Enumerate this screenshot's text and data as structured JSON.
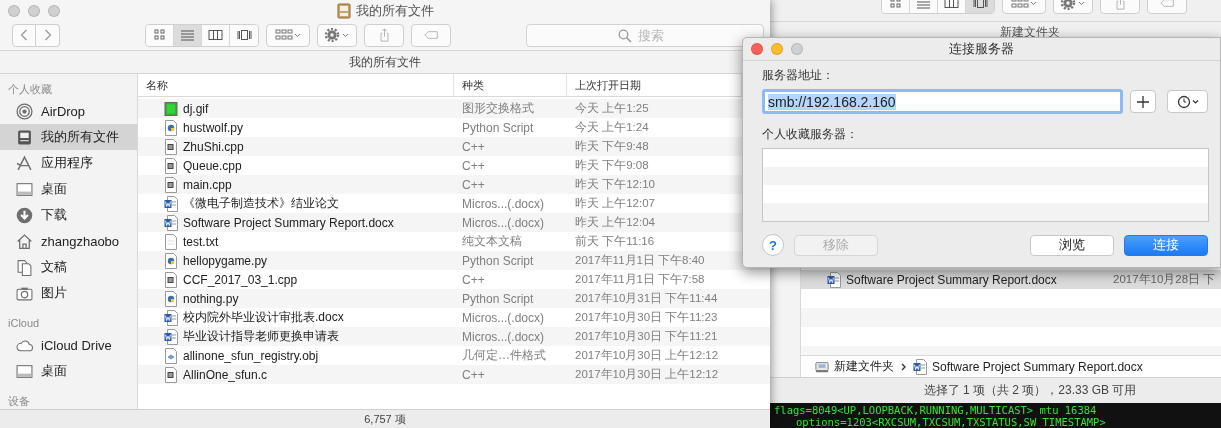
{
  "finder": {
    "active": false,
    "title": "我的所有文件",
    "view_modes": [
      {
        "kind": "icons",
        "selected": false
      },
      {
        "kind": "list",
        "selected": true
      },
      {
        "kind": "columns",
        "selected": false
      },
      {
        "kind": "coverflow",
        "selected": false
      }
    ],
    "search": {
      "placeholder": "搜索"
    },
    "path_title": "我的所有文件",
    "sidebar": [
      {
        "header": "个人收藏",
        "items": [
          {
            "kind": "airdrop",
            "label": "AirDrop",
            "selected": false
          },
          {
            "kind": "allfiles",
            "label": "我的所有文件",
            "selected": true
          },
          {
            "kind": "apps",
            "label": "应用程序",
            "selected": false
          },
          {
            "kind": "desktop",
            "label": "桌面",
            "selected": false
          },
          {
            "kind": "downloads",
            "label": "下载",
            "selected": false
          },
          {
            "kind": "home",
            "label": "zhangzhaobo",
            "selected": false
          },
          {
            "kind": "documents",
            "label": "文稿",
            "selected": false
          },
          {
            "kind": "pictures",
            "label": "图片",
            "selected": false
          }
        ]
      },
      {
        "header": "iCloud",
        "items": [
          {
            "kind": "icloud",
            "label": "iCloud Drive",
            "selected": false
          },
          {
            "kind": "desktop",
            "label": "桌面",
            "selected": false
          }
        ]
      },
      {
        "header": "设备"
      }
    ],
    "columns": [
      "名称",
      "种类",
      "上次打开日期"
    ],
    "rows": [
      {
        "kind": "gif",
        "name": "dj.gif",
        "type": "图形交换格式",
        "date": "今天 上午1:25"
      },
      {
        "kind": "py",
        "name": "hustwolf.py",
        "type": "Python Script",
        "date": "今天 上午1:24"
      },
      {
        "kind": "cpp",
        "name": "ZhuShi.cpp",
        "type": "C++",
        "date": "昨天 下午9:48"
      },
      {
        "kind": "cpp",
        "name": "Queue.cpp",
        "type": "C++",
        "date": "昨天 下午9:08"
      },
      {
        "kind": "cpp",
        "name": "main.cpp",
        "type": "C++",
        "date": "昨天 下午12:10"
      },
      {
        "kind": "docx",
        "name": "《微电子制造技术》结业论文",
        "type": "Micros...(.docx)",
        "date": "昨天 上午12:07"
      },
      {
        "kind": "docx",
        "name": "Software Project Summary Report.docx",
        "type": "Micros...(.docx)",
        "date": "昨天 上午12:04"
      },
      {
        "kind": "txt",
        "name": "test.txt",
        "type": "纯文本文稿",
        "date": "前天 下午11:16"
      },
      {
        "kind": "py",
        "name": "hellopygame.py",
        "type": "Python Script",
        "date": "2017年11月1日 下午8:40"
      },
      {
        "kind": "cpp",
        "name": "CCF_2017_03_1.cpp",
        "type": "C++",
        "date": "2017年11月1日 下午7:58"
      },
      {
        "kind": "py",
        "name": "nothing.py",
        "type": "Python Script",
        "date": "2017年10月31日 下午11:44"
      },
      {
        "kind": "docx",
        "name": "校内院外毕业设计审批表.docx",
        "type": "Micros...(.docx)",
        "date": "2017年10月30日 下午11:23"
      },
      {
        "kind": "docx",
        "name": "毕业设计指导老师更换申请表",
        "type": "Micros...(.docx)",
        "date": "2017年10月30日 下午11:21"
      },
      {
        "kind": "obj",
        "name": "allinone_sfun_registry.obj",
        "type": "几何定…件格式",
        "date": "2017年10月30日 上午12:12"
      },
      {
        "kind": "cpp",
        "name": "AllinOne_sfun.c",
        "type": "C++",
        "date": "2017年10月30日 上午12:12"
      }
    ],
    "status": "6,757 项"
  },
  "back_window": {
    "view_modes": [
      {
        "kind": "icons",
        "selected": false
      },
      {
        "kind": "list",
        "selected": false
      },
      {
        "kind": "columns",
        "selected": false
      },
      {
        "kind": "coverflow",
        "selected": true
      }
    ],
    "path_title": "新建文件夹",
    "rows": [
      {
        "kind": "docx",
        "name": "Software Project Summary Report.docx",
        "date": "2017年10月28日 下",
        "selected": true
      }
    ],
    "breadcrumb": [
      {
        "kind": "folder",
        "label": "新建文件夹"
      },
      {
        "kind": "docx",
        "label": "Software Project Summary Report.docx"
      }
    ],
    "status": "选择了 1 项（共 2 项），23.33 GB 可用"
  },
  "dialog": {
    "active": true,
    "title": "连接服务器",
    "address_label": "服务器地址：",
    "address": "smb://192.168.2.160",
    "address_selected": true,
    "favorites_label": "个人收藏服务器：",
    "buttons": [
      {
        "kind": "help",
        "label": "?"
      },
      {
        "kind": "text",
        "label": "移除",
        "disabled": true,
        "default": false
      },
      {
        "kind": "text",
        "label": "浏览",
        "disabled": false,
        "default": false
      },
      {
        "kind": "text",
        "label": "连接",
        "disabled": false,
        "default": true
      }
    ]
  },
  "terminal": {
    "lines": [
      "flags=8049<UP,LOOPBACK,RUNNING,MULTICAST> mtu 16384",
      "options=1203<RXCSUM,TXCSUM,TXSTATUS,SW_TIMESTAMP>"
    ]
  }
}
